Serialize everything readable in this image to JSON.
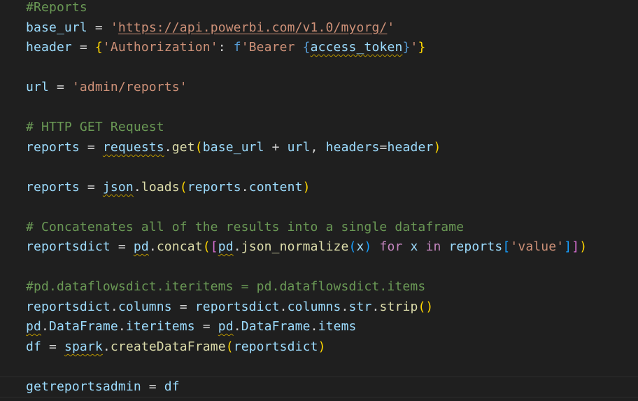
{
  "lines": {
    "l1": "#Reports",
    "l2": {
      "var": "base_url",
      "eq": " = ",
      "str": "'https://api.powerbi.com/v1.0/myorg/'"
    },
    "l3": {
      "var": "header",
      "eq": " = ",
      "open": "{",
      "key": "'Authorization'",
      "colon": ": ",
      "fpre": "f",
      "fstr1": "'Bearer ",
      "bopen": "{",
      "token": "access_token",
      "bclose": "}",
      "fstr2": "'",
      "close": "}"
    },
    "l5": {
      "var": "url",
      "eq": " = ",
      "str": "'admin/reports'"
    },
    "l7": "# HTTP GET Request",
    "l8": {
      "var": "reports",
      "eq": " = ",
      "mod": "requests",
      "dot": ".",
      "fn": "get",
      "open": "(",
      "a1": "base_url",
      "plus": " + ",
      "a2": "url",
      "comma": ", ",
      "kw": "headers",
      "kweq": "=",
      "a3": "header",
      "close": ")"
    },
    "l10": {
      "var": "reports",
      "eq": " = ",
      "mod": "json",
      "dot": ".",
      "fn": "loads",
      "open": "(",
      "a1": "reports",
      "dot2": ".",
      "a2": "content",
      "close": ")"
    },
    "l12": "# Concatenates all of the results into a single dataframe",
    "l13": {
      "var": "reportsdict",
      "eq": " = ",
      "mod": "pd",
      "dot": ".",
      "fn": "concat",
      "open1": "(",
      "open2": "[",
      "mod2": "pd",
      "dot2": ".",
      "fn2": "json_normalize",
      "open3": "(",
      "x1": "x",
      "close3": ")",
      "for": " for ",
      "x2": "x",
      "in": " in ",
      "a1": "reports",
      "open4": "[",
      "s1": "'value'",
      "close4": "]",
      "close2": "]",
      "close1": ")"
    },
    "l15": "#pd.dataflowsdict.iteritems = pd.dataflowsdict.items",
    "l16": {
      "v1": "reportsdict",
      "d1": ".",
      "v2": "columns",
      "eq": " = ",
      "v3": "reportsdict",
      "d2": ".",
      "v4": "columns",
      "d3": ".",
      "v5": "str",
      "d4": ".",
      "fn": "strip",
      "paren": "()"
    },
    "l17": {
      "m1": "pd",
      "d1": ".",
      "c1": "DataFrame",
      "d2": ".",
      "v1": "iteritems",
      "eq": " = ",
      "m2": "pd",
      "d3": ".",
      "c2": "DataFrame",
      "d4": ".",
      "v2": "items"
    },
    "l18": {
      "var": "df",
      "eq": " = ",
      "mod": "spark",
      "dot": ".",
      "fn": "createDataFrame",
      "open": "(",
      "a1": "reportsdict",
      "close": ")"
    },
    "l20": {
      "var": "getreportsadmin",
      "eq": " = ",
      "v2": "df"
    }
  },
  "colors": {
    "background": "#1f1f1f",
    "comment": "#6a9955",
    "variable": "#9cdcfe",
    "string": "#ce9178",
    "function": "#dcdcaa",
    "keyword": "#c586c0",
    "bracket_gold": "#ffd700",
    "bracket_orchid": "#da70d6",
    "bracket_blue": "#179fff"
  }
}
